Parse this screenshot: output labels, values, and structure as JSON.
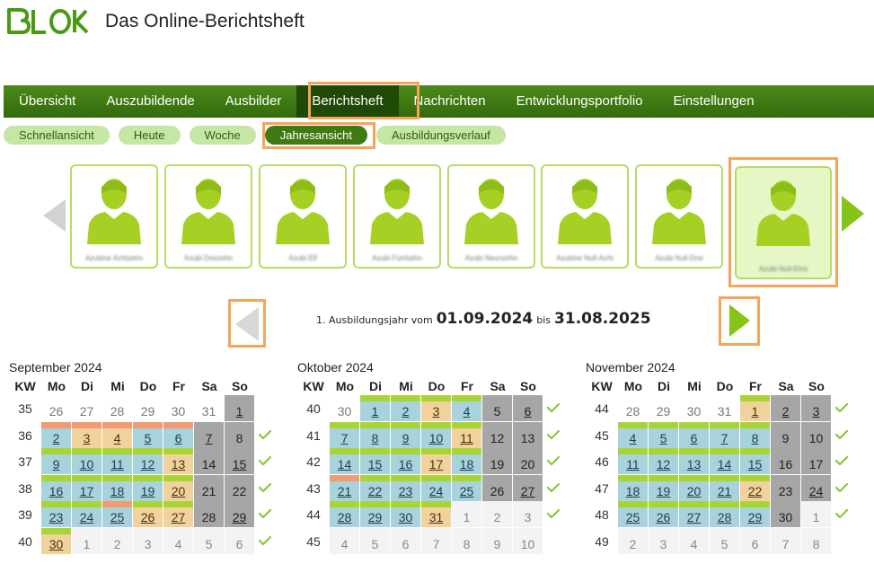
{
  "header": {
    "logo_text": "BLok",
    "title": "Das Online-Berichtsheft"
  },
  "main_nav": [
    "Übersicht",
    "Auszubildende",
    "Ausbilder",
    "Berichtsheft",
    "Nachrichten",
    "Entwicklungsportfolio",
    "Einstellungen"
  ],
  "main_nav_active": "Berichtsheft",
  "sub_nav": [
    "Schnellansicht",
    "Heute",
    "Woche",
    "Jahresansicht",
    "Ausbildungsverlauf"
  ],
  "sub_nav_active": "Jahresansicht",
  "trainees": [
    "Azubine Achtzehn",
    "Azubi Dreizehn",
    "Azubi Elf",
    "Azubi Fünfzehn",
    "Azubi Neunzehn",
    "Azubine Null-Acht",
    "Azubi Null-Drei",
    "Azubi Null-Eins"
  ],
  "selected_trainee_index": 7,
  "year": {
    "prefix": "1. Ausbildungsjahr vom",
    "start": "01.09.2024",
    "between": "bis",
    "end": "31.08.2025"
  },
  "weekday_header": [
    "KW",
    "Mo",
    "Di",
    "Mi",
    "Do",
    "Fr",
    "Sa",
    "So"
  ],
  "colors": {
    "accent": "#3f7a12",
    "highlight": "#f5a55a",
    "current": "#a8d2dc",
    "vacation": "#f2d29c",
    "weekend": "#a6a6a6",
    "ok_bar": "#a9d534",
    "warn_bar": "#f29a73"
  },
  "months": [
    {
      "title": "September 2024",
      "weeks": [
        {
          "kw": "35",
          "check": false,
          "days": [
            {
              "d": "26",
              "t": "out"
            },
            {
              "d": "27",
              "t": "out"
            },
            {
              "d": "28",
              "t": "out"
            },
            {
              "d": "29",
              "t": "out"
            },
            {
              "d": "30",
              "t": "out"
            },
            {
              "d": "31",
              "t": "out"
            },
            {
              "d": "1",
              "t": "wkd",
              "u": true
            }
          ]
        },
        {
          "kw": "36",
          "check": true,
          "days": [
            {
              "d": "2",
              "t": "cur",
              "b": "warn"
            },
            {
              "d": "3",
              "t": "vac",
              "b": "warn"
            },
            {
              "d": "4",
              "t": "vac",
              "b": "warn"
            },
            {
              "d": "5",
              "t": "cur",
              "b": "warn"
            },
            {
              "d": "6",
              "t": "cur",
              "b": "warn"
            },
            {
              "d": "7",
              "t": "wkd",
              "u": true
            },
            {
              "d": "8",
              "t": "wkd"
            }
          ]
        },
        {
          "kw": "37",
          "check": true,
          "days": [
            {
              "d": "9",
              "t": "cur",
              "b": "ok"
            },
            {
              "d": "10",
              "t": "cur",
              "b": "ok"
            },
            {
              "d": "11",
              "t": "cur",
              "b": "ok"
            },
            {
              "d": "12",
              "t": "cur",
              "b": "ok"
            },
            {
              "d": "13",
              "t": "vac",
              "b": "ok"
            },
            {
              "d": "14",
              "t": "wkd"
            },
            {
              "d": "15",
              "t": "wkd",
              "u": true
            }
          ]
        },
        {
          "kw": "38",
          "check": true,
          "days": [
            {
              "d": "16",
              "t": "cur",
              "b": "ok"
            },
            {
              "d": "17",
              "t": "cur",
              "b": "ok"
            },
            {
              "d": "18",
              "t": "cur",
              "b": "ok"
            },
            {
              "d": "19",
              "t": "cur",
              "b": "ok"
            },
            {
              "d": "20",
              "t": "vac",
              "b": "ok"
            },
            {
              "d": "21",
              "t": "wkd"
            },
            {
              "d": "22",
              "t": "wkd"
            }
          ]
        },
        {
          "kw": "39",
          "check": true,
          "days": [
            {
              "d": "23",
              "t": "cur",
              "b": "ok"
            },
            {
              "d": "24",
              "t": "cur",
              "b": "ok"
            },
            {
              "d": "25",
              "t": "cur",
              "b": "warn"
            },
            {
              "d": "26",
              "t": "vac",
              "b": "ok"
            },
            {
              "d": "27",
              "t": "vac",
              "b": "ok"
            },
            {
              "d": "28",
              "t": "wkd"
            },
            {
              "d": "29",
              "t": "wkd",
              "u": true
            }
          ]
        },
        {
          "kw": "40",
          "check": true,
          "days": [
            {
              "d": "30",
              "t": "vac",
              "b": "ok"
            },
            {
              "d": "1",
              "t": "out fut"
            },
            {
              "d": "2",
              "t": "out fut"
            },
            {
              "d": "3",
              "t": "out fut"
            },
            {
              "d": "4",
              "t": "out fut"
            },
            {
              "d": "5",
              "t": "out fut"
            },
            {
              "d": "6",
              "t": "out fut"
            }
          ]
        }
      ]
    },
    {
      "title": "Oktober 2024",
      "weeks": [
        {
          "kw": "40",
          "check": true,
          "days": [
            {
              "d": "30",
              "t": "out"
            },
            {
              "d": "1",
              "t": "cur",
              "b": "ok"
            },
            {
              "d": "2",
              "t": "cur",
              "b": "ok"
            },
            {
              "d": "3",
              "t": "vac",
              "b": "ok"
            },
            {
              "d": "4",
              "t": "cur",
              "b": "ok"
            },
            {
              "d": "5",
              "t": "wkd"
            },
            {
              "d": "6",
              "t": "wkd",
              "u": true
            }
          ]
        },
        {
          "kw": "41",
          "check": true,
          "days": [
            {
              "d": "7",
              "t": "cur",
              "b": "ok"
            },
            {
              "d": "8",
              "t": "cur",
              "b": "ok"
            },
            {
              "d": "9",
              "t": "cur",
              "b": "ok"
            },
            {
              "d": "10",
              "t": "cur",
              "b": "ok"
            },
            {
              "d": "11",
              "t": "vac",
              "b": "ok"
            },
            {
              "d": "12",
              "t": "wkd"
            },
            {
              "d": "13",
              "t": "wkd"
            }
          ]
        },
        {
          "kw": "42",
          "check": true,
          "days": [
            {
              "d": "14",
              "t": "cur",
              "b": "ok"
            },
            {
              "d": "15",
              "t": "cur",
              "b": "ok"
            },
            {
              "d": "16",
              "t": "cur",
              "b": "ok"
            },
            {
              "d": "17",
              "t": "vac",
              "b": "ok"
            },
            {
              "d": "18",
              "t": "cur",
              "b": "ok"
            },
            {
              "d": "19",
              "t": "wkd"
            },
            {
              "d": "20",
              "t": "wkd"
            }
          ]
        },
        {
          "kw": "43",
          "check": true,
          "days": [
            {
              "d": "21",
              "t": "cur",
              "b": "warn"
            },
            {
              "d": "22",
              "t": "cur",
              "b": "ok"
            },
            {
              "d": "23",
              "t": "cur",
              "b": "ok"
            },
            {
              "d": "24",
              "t": "cur",
              "b": "ok"
            },
            {
              "d": "25",
              "t": "cur",
              "b": "ok"
            },
            {
              "d": "26",
              "t": "wkd"
            },
            {
              "d": "27",
              "t": "wkd",
              "u": true
            }
          ]
        },
        {
          "kw": "44",
          "check": true,
          "days": [
            {
              "d": "28",
              "t": "cur",
              "b": "ok"
            },
            {
              "d": "29",
              "t": "cur",
              "b": "ok"
            },
            {
              "d": "30",
              "t": "cur",
              "b": "ok"
            },
            {
              "d": "31",
              "t": "vac",
              "b": "ok"
            },
            {
              "d": "1",
              "t": "out fut"
            },
            {
              "d": "2",
              "t": "out fut"
            },
            {
              "d": "3",
              "t": "out fut"
            }
          ]
        },
        {
          "kw": "45",
          "check": false,
          "days": [
            {
              "d": "4",
              "t": "out fut"
            },
            {
              "d": "5",
              "t": "out fut"
            },
            {
              "d": "6",
              "t": "out fut"
            },
            {
              "d": "7",
              "t": "out fut"
            },
            {
              "d": "8",
              "t": "out fut"
            },
            {
              "d": "9",
              "t": "out fut"
            },
            {
              "d": "10",
              "t": "out fut"
            }
          ]
        }
      ]
    },
    {
      "title": "November 2024",
      "weeks": [
        {
          "kw": "44",
          "check": true,
          "days": [
            {
              "d": "28",
              "t": "out"
            },
            {
              "d": "29",
              "t": "out"
            },
            {
              "d": "30",
              "t": "out"
            },
            {
              "d": "31",
              "t": "out"
            },
            {
              "d": "1",
              "t": "vac",
              "b": "ok"
            },
            {
              "d": "2",
              "t": "wkd",
              "u": true
            },
            {
              "d": "3",
              "t": "wkd",
              "u": true
            }
          ]
        },
        {
          "kw": "45",
          "check": true,
          "days": [
            {
              "d": "4",
              "t": "cur",
              "b": "ok"
            },
            {
              "d": "5",
              "t": "cur",
              "b": "ok"
            },
            {
              "d": "6",
              "t": "cur",
              "b": "ok"
            },
            {
              "d": "7",
              "t": "cur",
              "b": "ok"
            },
            {
              "d": "8",
              "t": "cur",
              "b": "ok"
            },
            {
              "d": "9",
              "t": "wkd"
            },
            {
              "d": "10",
              "t": "wkd"
            }
          ]
        },
        {
          "kw": "46",
          "check": true,
          "days": [
            {
              "d": "11",
              "t": "cur",
              "b": "ok"
            },
            {
              "d": "12",
              "t": "cur",
              "b": "ok"
            },
            {
              "d": "13",
              "t": "cur",
              "b": "ok"
            },
            {
              "d": "14",
              "t": "cur",
              "b": "ok"
            },
            {
              "d": "15",
              "t": "cur",
              "b": "ok"
            },
            {
              "d": "16",
              "t": "wkd"
            },
            {
              "d": "17",
              "t": "wkd"
            }
          ]
        },
        {
          "kw": "47",
          "check": true,
          "days": [
            {
              "d": "18",
              "t": "cur",
              "b": "ok"
            },
            {
              "d": "19",
              "t": "cur",
              "b": "ok"
            },
            {
              "d": "20",
              "t": "cur",
              "b": "ok"
            },
            {
              "d": "21",
              "t": "cur",
              "b": "ok"
            },
            {
              "d": "22",
              "t": "vac",
              "b": "ok"
            },
            {
              "d": "23",
              "t": "wkd"
            },
            {
              "d": "24",
              "t": "wkd",
              "u": true
            }
          ]
        },
        {
          "kw": "48",
          "check": true,
          "days": [
            {
              "d": "25",
              "t": "cur",
              "b": "ok"
            },
            {
              "d": "26",
              "t": "cur",
              "b": "ok"
            },
            {
              "d": "27",
              "t": "cur",
              "b": "ok"
            },
            {
              "d": "28",
              "t": "cur",
              "b": "ok"
            },
            {
              "d": "29",
              "t": "cur",
              "b": "ok"
            },
            {
              "d": "30",
              "t": "wkd"
            },
            {
              "d": "1",
              "t": "out fut"
            }
          ]
        },
        {
          "kw": "49",
          "check": false,
          "days": [
            {
              "d": "2",
              "t": "out fut"
            },
            {
              "d": "3",
              "t": "out fut"
            },
            {
              "d": "4",
              "t": "out fut"
            },
            {
              "d": "5",
              "t": "out fut"
            },
            {
              "d": "6",
              "t": "out fut"
            },
            {
              "d": "7",
              "t": "out fut"
            },
            {
              "d": "8",
              "t": "out fut"
            }
          ]
        }
      ]
    }
  ]
}
